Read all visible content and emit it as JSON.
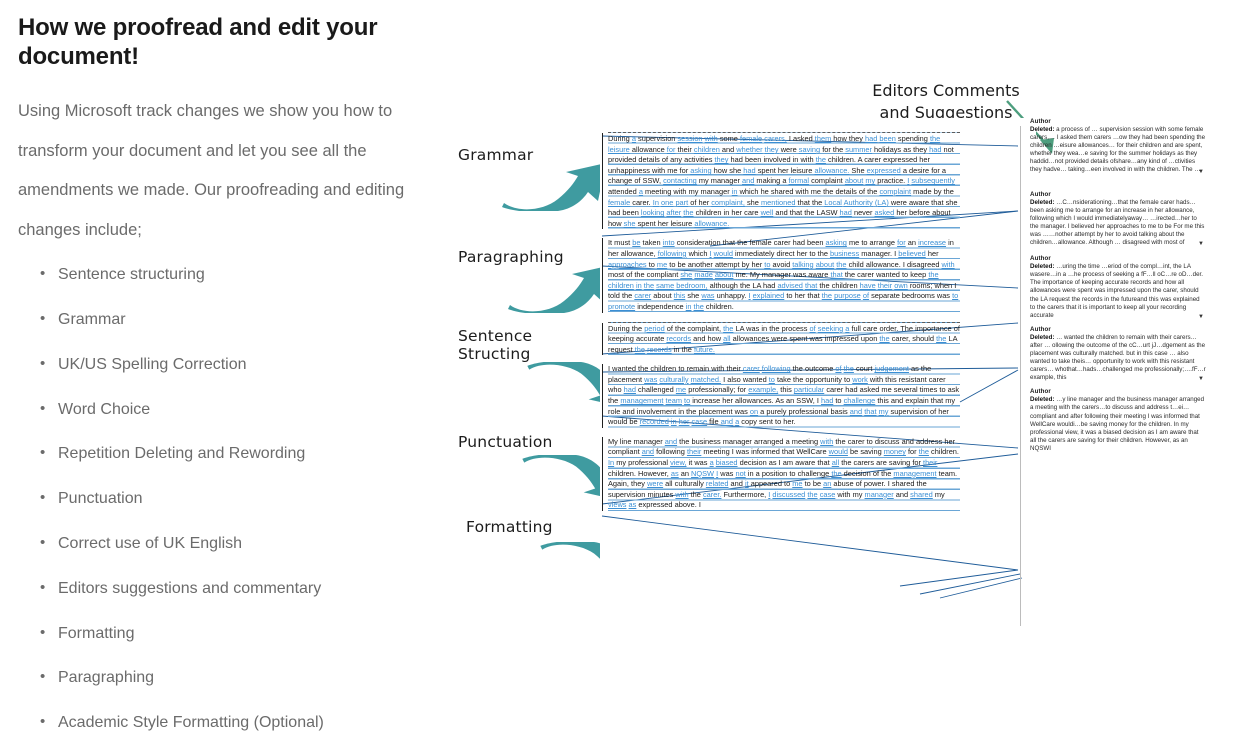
{
  "page": {
    "title": "How we proofread and edit your document!",
    "intro": "Using Microsoft track changes we show you how to transform your document and let you see all the amendments we made. Our proofreading and editing changes include;",
    "services": [
      "Sentence structuring",
      "Grammar",
      "UK/US Spelling Correction",
      "Word Choice",
      "Repetition Deleting and Rewording",
      "Punctuation",
      "Correct use of UK English",
      "Editors suggestions and commentary",
      "Formatting",
      "Paragraphing",
      "Academic Style Formatting (Optional)"
    ]
  },
  "callouts": [
    {
      "label": "Grammar"
    },
    {
      "label": "Paragraphing"
    },
    {
      "label": "Sentence\nStructing"
    },
    {
      "label": "Punctuation"
    },
    {
      "label": "Formatting"
    }
  ],
  "document": {
    "header_label": "Editors Comments\nand Suggestions",
    "paragraphs": [
      {
        "id": "para-1",
        "text": "During a supervision session with some female carers, I asked them how they had been spending the leisure allowance for their children and whether they were saving for the summer holidays as they had not provided details of any activities they had been involved in with the children. A carer expressed her unhappiness with me for asking how she had spent her leisure allowance. She expressed a desire for a change of SSW, contacting my manager and making a formal complaint about my practice. I subsequently attended a meeting with my manager in which he shared with me the details of the complaint made by the female carer. In one part of her complaint, she mentioned that the Local Authority (LA) were aware that she had been looking after the children in her care well and that the LASW had never asked her before about how she spent her leisure allowance."
      },
      {
        "id": "para-2",
        "text": "It must be taken into consideration that the female carer had been asking me to arrange for an increase in her allowance, following which I would immediately direct her to the business manager. I believed her approaches to me to be another attempt by her to avoid talking about the child allowance. I disagreed with most of the compliant she made about me. My manager was aware that the carer wanted to keep the children in the same bedroom, although the LA had advised that the children have their own rooms; when I told the carer about this she was unhappy. I explained to her that the purpose of separate bedrooms was to promote independence in the children."
      },
      {
        "id": "para-3",
        "text": "During the period of the complaint, the LA was in the process of seeking a full care order. The importance of keeping accurate records and how all allowances were spent was impressed upon the carer, should the LA request the records in the future."
      },
      {
        "id": "para-4",
        "text": "I wanted the children to remain with their carer following the outcome of the court judgement as the placement was culturally matched. I also wanted to take the opportunity to work with this resistant carer who had challenged me professionally; for example, this particular carer had asked me several times to ask the management team to increase her allowances. As an SSW, I had to challenge this and explain that my role and involvement in the placement was on a purely professional basis and that my supervision of her would be recorded in her case file and a copy sent to her."
      },
      {
        "id": "para-5",
        "text": "My line manager and the business manager arranged a meeting with the carer to discuss and address her compliant and following their meeting I was informed that WellCare would be saving money for the children. In my professional view, it was a biased decision as I am aware that all the carers are saving for their children. However, as an NQSW I was not in a position to challenge the decision of the management team. Again, they were all culturally related and it appeared to me to be an abuse of power. I shared the supervision minutes with the carer. Furthermore, I discussed the case with my manager and shared my views as expressed above. I"
      }
    ]
  },
  "comments": {
    "author_label": "Author",
    "deleted_label": "Deleted:",
    "more_glyph": "▼",
    "items": [
      {
        "author": "Author",
        "prefix": "Deleted:",
        "text": " a process of … supervision session with some female carers,… I asked them carers …ow they had been spending the children …eisure allowances… for their children and are spent, whether they wea…e saving for the summer holidays as they haddid…not provided details ofshare…any kind of …ctivities they hadve… taking…een involved in with the children. The …"
      },
      {
        "author": "Author",
        "prefix": "Deleted:",
        "text": " …C…nsiderationing…that the female carer hads…been asking me to arrange for an increase in her allowance, following which I would immediatelyaway… …irected…her to the manager. I believed her approaches to me to be For me this was ……nother attempt by her to avoid talking about the children…allowance. Although … disagreed with most of"
      },
      {
        "author": "Author",
        "prefix": "Deleted:",
        "text": " …uring the time …eriod of the compl…int, the LA wasere…in a …he process of seeking a fF…ll oC…re oD…der. The importance of keeping accurate records and how all allowances were spent was impressed upon the carer, should the LA request the records in the futureand this was explained to the carers that it is important to keep all your recording accurate"
      },
      {
        "author": "Author",
        "prefix": "Deleted:",
        "text": " … wanted the children to remain with their carers… after … ollowing the outcome of the cC…urt jJ…dgement as the placement was culturally matched. but in this case … also wanted to take theis… opportunity to work with this resistant carers… whothat…hads…challenged me professionally;….fF…r example, this"
      },
      {
        "author": "Author",
        "prefix": "Deleted:",
        "text": " …y line manager and the business manager arranged a meeting with the carers…to discuss and address t…ei… compliant and after following their meeting I was informed that WellCare wouldi…be saving money for the children. In my professional view, it was a biased decision as I am aware that all the carers are saving for their children. However, as an NQSWI"
      }
    ]
  },
  "colors": {
    "arrow_teal": "#3f9ba0",
    "header_arrow_green": "#4d9e7e",
    "ink_dark_blue": "#17365d",
    "insertion_blue": "#3b8fd4",
    "body_gray": "#6b6b6b",
    "title_black": "#1a1a1a"
  }
}
